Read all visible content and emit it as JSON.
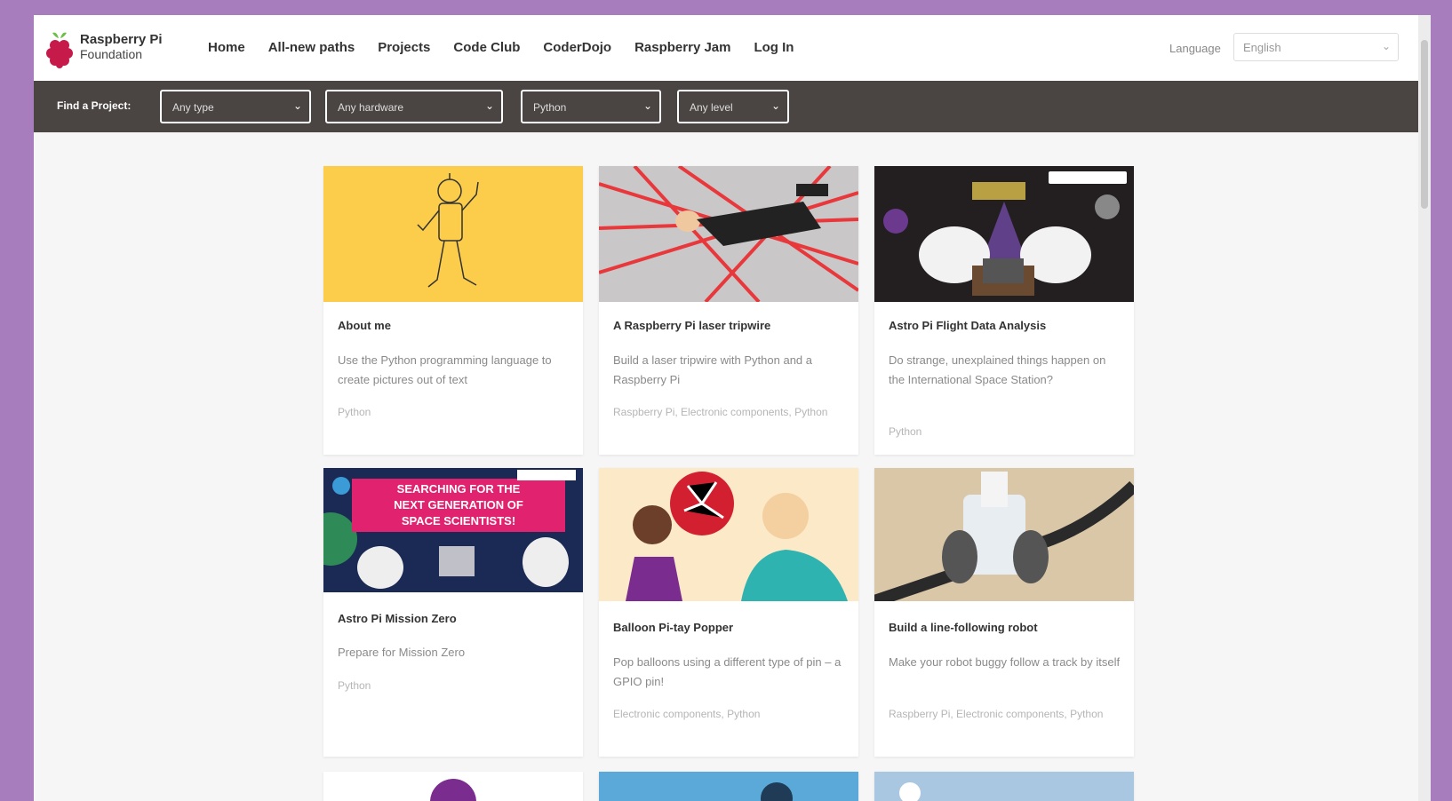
{
  "brand": {
    "line1": "Raspberry Pi",
    "line2": "Foundation"
  },
  "nav": [
    "Home",
    "All-new paths",
    "Projects",
    "Code Club",
    "CoderDojo",
    "Raspberry Jam",
    "Log In"
  ],
  "language": {
    "label": "Language",
    "value": "English"
  },
  "filters": {
    "label": "Find a Project:",
    "selects": [
      "Any type",
      "Any hardware",
      "Python",
      "Any level"
    ]
  },
  "cards": [
    {
      "title": "About me",
      "description": "Use the Python programming language to create pictures out of text",
      "tags": "Python"
    },
    {
      "title": "A Raspberry Pi laser tripwire",
      "description": "Build a laser tripwire with Python and a Raspberry Pi",
      "tags": "Raspberry Pi, Electronic components, Python"
    },
    {
      "title": "Astro Pi Flight Data Analysis",
      "description": "Do strange, unexplained things happen on the International Space Station?",
      "tags": "Python"
    },
    {
      "title": "Astro Pi Mission Zero",
      "description": "Prepare for Mission Zero",
      "tags": "Python"
    },
    {
      "title": "Balloon Pi-tay Popper",
      "description": "Pop balloons using a different type of pin – a GPIO pin!",
      "tags": "Electronic components, Python"
    },
    {
      "title": "Build a line-following robot",
      "description": "Make your robot buggy follow a track by itself",
      "tags": "Raspberry Pi, Electronic components, Python"
    }
  ],
  "card_banner_text": [
    "SEARCHING FOR THE",
    "NEXT GENERATION OF",
    "SPACE SCIENTISTS!"
  ],
  "colors": {
    "purple_bg": "#a77dbd",
    "filter_bar": "#4a4542",
    "brand_red": "#c51a4a",
    "brand_green": "#6cc04a"
  }
}
